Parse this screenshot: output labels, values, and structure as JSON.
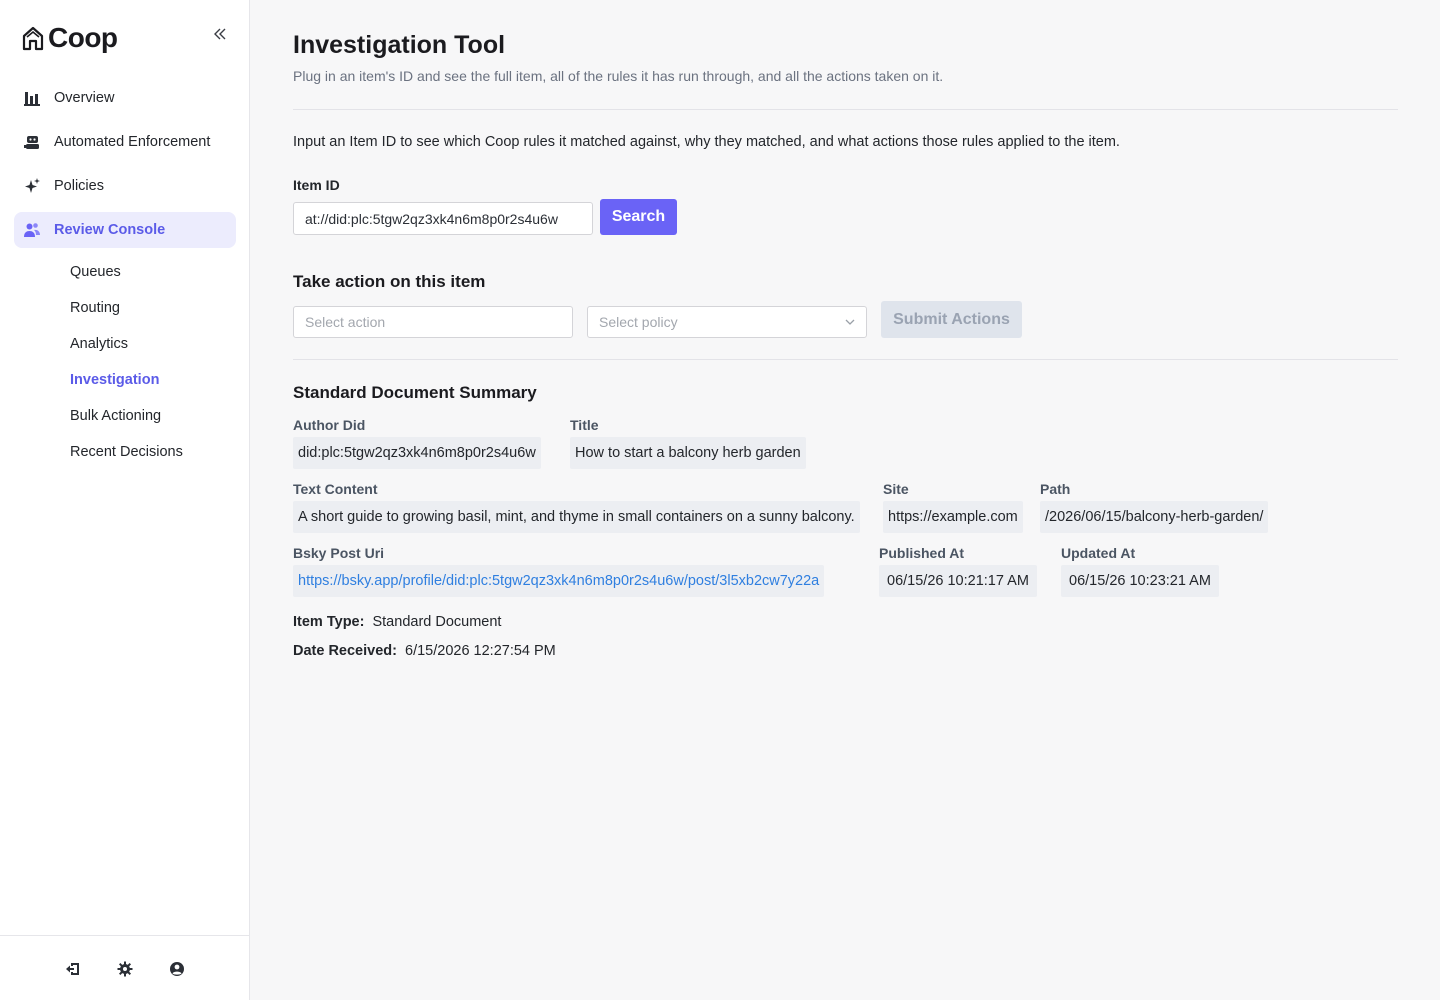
{
  "app": {
    "name": "Coop"
  },
  "sidebar": {
    "items": [
      {
        "label": "Overview",
        "icon": "bar-chart-icon"
      },
      {
        "label": "Automated Enforcement",
        "icon": "robot-icon"
      },
      {
        "label": "Policies",
        "icon": "sparkles-icon"
      },
      {
        "label": "Review Console",
        "icon": "users-icon",
        "active": true
      }
    ],
    "sub_items": [
      {
        "label": "Queues"
      },
      {
        "label": "Routing"
      },
      {
        "label": "Analytics"
      },
      {
        "label": "Investigation",
        "active": true
      },
      {
        "label": "Bulk Actioning"
      },
      {
        "label": "Recent Decisions"
      }
    ],
    "footer_icons": [
      "logout-icon",
      "gear-icon",
      "user-circle-icon"
    ]
  },
  "page": {
    "title": "Investigation Tool",
    "subtitle": "Plug in an item's ID and see the full item, all of the rules it has run through, and all the actions taken on it.",
    "intro": "Input an Item ID to see which Coop rules it matched against, why they matched, and what actions those rules applied to the item."
  },
  "search": {
    "label": "Item ID",
    "value": "at://did:plc:5tgw2qz3xk4n6m8p0r2s4u6w",
    "button": "Search"
  },
  "action": {
    "title": "Take action on this item",
    "select_action_placeholder": "Select action",
    "select_policy_placeholder": "Select policy",
    "submit": "Submit Actions"
  },
  "summary": {
    "title": "Standard Document Summary",
    "author_did_label": "Author Did",
    "author_did": "did:plc:5tgw2qz3xk4n6m8p0r2s4u6w",
    "title_label": "Title",
    "title_value": "How to start a balcony herb garden",
    "text_content_label": "Text Content",
    "text_content": "A short guide to growing basil, mint, and thyme in small containers on a sunny balcony.",
    "site_label": "Site",
    "site": "https://example.com",
    "path_label": "Path",
    "path": "/2026/06/15/balcony-herb-garden/",
    "bsky_label": "Bsky Post Uri",
    "bsky": "https://bsky.app/profile/did:plc:5tgw2qz3xk4n6m8p0r2s4u6w/post/3l5xb2cw7y22a",
    "published_label": "Published At",
    "published": "06/15/26 10:21:17 AM",
    "updated_label": "Updated At",
    "updated": "06/15/26 10:23:21 AM",
    "item_type_label": "Item Type:",
    "item_type": "Standard Document",
    "date_received_label": "Date Received:",
    "date_received": "6/15/2026 12:27:54 PM"
  },
  "colors": {
    "accent": "#6a63f6",
    "active_text": "#5b5be8",
    "active_bg": "#ececfd",
    "link": "#2f7fe0"
  }
}
